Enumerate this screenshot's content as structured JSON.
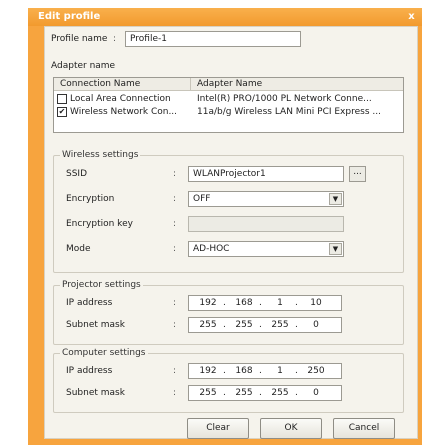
{
  "window": {
    "title": "Edit profile",
    "close_glyph": "x"
  },
  "profile": {
    "label": "Profile name",
    "colon": ":",
    "value": "Profile-1"
  },
  "adapter": {
    "label": "Adapter name",
    "columns": [
      "Connection Name",
      "Adapter Name"
    ],
    "rows": [
      {
        "checked": false,
        "check_glyph": "",
        "connection": "Local Area Connection",
        "adapter": "Intel(R) PRO/1000 PL Network Conne..."
      },
      {
        "checked": true,
        "check_glyph": "✔",
        "connection": "Wireless Network Con...",
        "adapter": "11a/b/g Wireless LAN Mini PCI Express ..."
      }
    ]
  },
  "wireless": {
    "title": "Wireless settings",
    "ssid_label": "SSID",
    "ssid_value": "WLANProjector1",
    "browse_label": "...",
    "encryption_label": "Encryption",
    "encryption_value": "OFF",
    "encryption_key_label": "Encryption key",
    "encryption_key_value": "",
    "mode_label": "Mode",
    "mode_value": "AD-HOC",
    "colon": ":"
  },
  "projector": {
    "title": "Projector settings",
    "ip_label": "IP address",
    "ip": [
      "192",
      "168",
      "1",
      "10"
    ],
    "mask_label": "Subnet mask",
    "mask": [
      "255",
      "255",
      "255",
      "0"
    ],
    "colon": ":"
  },
  "computer": {
    "title": "Computer settings",
    "ip_label": "IP address",
    "ip": [
      "192",
      "168",
      "1",
      "250"
    ],
    "mask_label": "Subnet mask",
    "mask": [
      "255",
      "255",
      "255",
      "0"
    ],
    "colon": ":"
  },
  "ip_dot": ".",
  "dropdown_glyph": "▼",
  "buttons": {
    "clear": "Clear",
    "ok": "OK",
    "cancel": "Cancel"
  }
}
